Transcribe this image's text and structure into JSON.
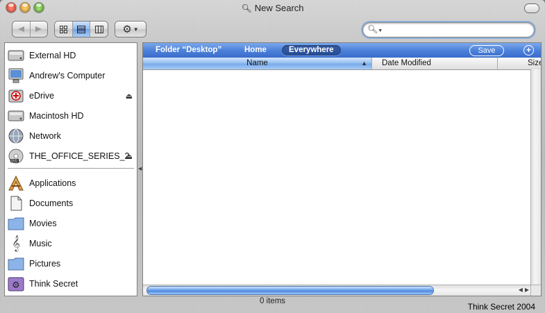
{
  "window": {
    "title": "New Search"
  },
  "toolbar": {
    "back_icon": "arrow-left-icon",
    "forward_icon": "arrow-right-icon",
    "view_modes": [
      "icon-view-icon",
      "list-view-icon",
      "column-view-icon"
    ],
    "selected_view": "list",
    "action_icon": "gear-icon",
    "search": {
      "value": "",
      "placeholder": ""
    }
  },
  "sidebar": {
    "devices": [
      {
        "label": "External HD",
        "icon": "external-drive-icon",
        "eject": false
      },
      {
        "label": "Andrew's Computer",
        "icon": "computer-icon",
        "eject": false
      },
      {
        "label": "eDrive",
        "icon": "edrive-icon",
        "eject": true
      },
      {
        "label": "Macintosh HD",
        "icon": "hard-drive-icon",
        "eject": false
      },
      {
        "label": "Network",
        "icon": "network-globe-icon",
        "eject": false
      },
      {
        "label": "THE_OFFICE_SERIES_2",
        "icon": "dvd-icon",
        "eject": true
      }
    ],
    "places": [
      {
        "label": "Applications",
        "icon": "applications-icon"
      },
      {
        "label": "Documents",
        "icon": "documents-icon"
      },
      {
        "label": "Movies",
        "icon": "movies-folder-icon"
      },
      {
        "label": "Music",
        "icon": "music-clef-icon"
      },
      {
        "label": "Pictures",
        "icon": "pictures-folder-icon"
      },
      {
        "label": "Think Secret",
        "icon": "think-secret-icon"
      }
    ]
  },
  "scope_bar": {
    "scopes": [
      "Folder “Desktop”",
      "Home",
      "Everywhere"
    ],
    "selected": "Everywhere",
    "save_label": "Save"
  },
  "columns": [
    "Name",
    "Date Modified",
    "Size"
  ],
  "sorted_column": "Name",
  "status": {
    "items": "0 items"
  },
  "watermark": "Think Secret 2004",
  "colors": {
    "scope_bar": "#4a7fd9",
    "selection": "#77a9eb"
  }
}
